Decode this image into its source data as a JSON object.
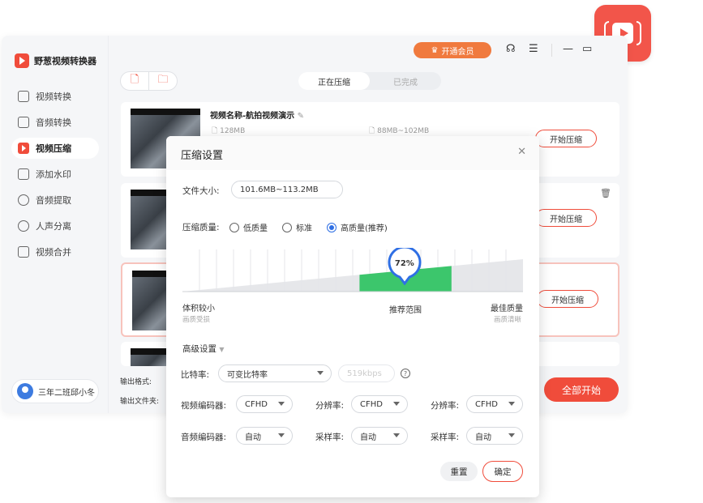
{
  "app": {
    "title": "野葱视频转换器"
  },
  "sidebar": {
    "items": [
      {
        "label": "视频转换",
        "icon": "video-convert-icon",
        "active": false
      },
      {
        "label": "音频转换",
        "icon": "audio-convert-icon",
        "active": false
      },
      {
        "label": "视频压缩",
        "icon": "video-compress-icon",
        "active": true
      },
      {
        "label": "添加水印",
        "icon": "watermark-icon",
        "active": false
      },
      {
        "label": "音频提取",
        "icon": "audio-extract-icon",
        "active": false
      },
      {
        "label": "人声分离",
        "icon": "voice-separate-icon",
        "active": false
      },
      {
        "label": "视频合并",
        "icon": "video-merge-icon",
        "active": false
      }
    ],
    "user": "三年二班邱小冬"
  },
  "topbar": {
    "vip_label": "开通会员"
  },
  "tabs": {
    "compressing": "正在压缩",
    "done": "已完成"
  },
  "file": {
    "name": "视频名称-航拍视频演示",
    "size": "128MB",
    "output_size": "88MB~102MB",
    "start_label": "开始压缩"
  },
  "footer": {
    "format_label": "输出格式:",
    "folder_label": "输出文件夹:",
    "start_all": "全部开始"
  },
  "dialog": {
    "title": "压缩设置",
    "file_size_label": "文件大小:",
    "file_size_value": "101.6MB~113.2MB",
    "quality_label": "压缩质量:",
    "quality_options": [
      "低质量",
      "标准",
      "高质量(推荐)"
    ],
    "quality_selected": 2,
    "quality_percent": 72,
    "quality_display": "72%",
    "scale_left": "体积较小",
    "scale_left_sub": "画质受损",
    "scale_mid": "推荐范围",
    "scale_right": "最佳质量",
    "scale_right_sub": "画质清晰",
    "advanced_label": "高级设置",
    "bitrate_label": "比特率:",
    "bitrate_value": "可变比特率",
    "bitrate_kbps": "519kbps",
    "video_encoder_label": "视频编码器:",
    "video_encoder_value": "CFHD",
    "resolution_label": "分辨率:",
    "resolution_value": "CFHD",
    "resolution2_label": "分辨率:",
    "resolution2_value": "CFHD",
    "audio_encoder_label": "音频编码器:",
    "audio_encoder_value": "自动",
    "sample_rate_label": "采样率:",
    "sample_rate_value": "自动",
    "sample_rate2_label": "采样率:",
    "sample_rate2_value": "自动",
    "reset_label": "重置",
    "ok_label": "确定"
  },
  "colors": {
    "accent": "#f04c3b",
    "vip": "#f07a3e",
    "quality_green": "#3cc66c",
    "radio_blue": "#2f6fe4"
  }
}
